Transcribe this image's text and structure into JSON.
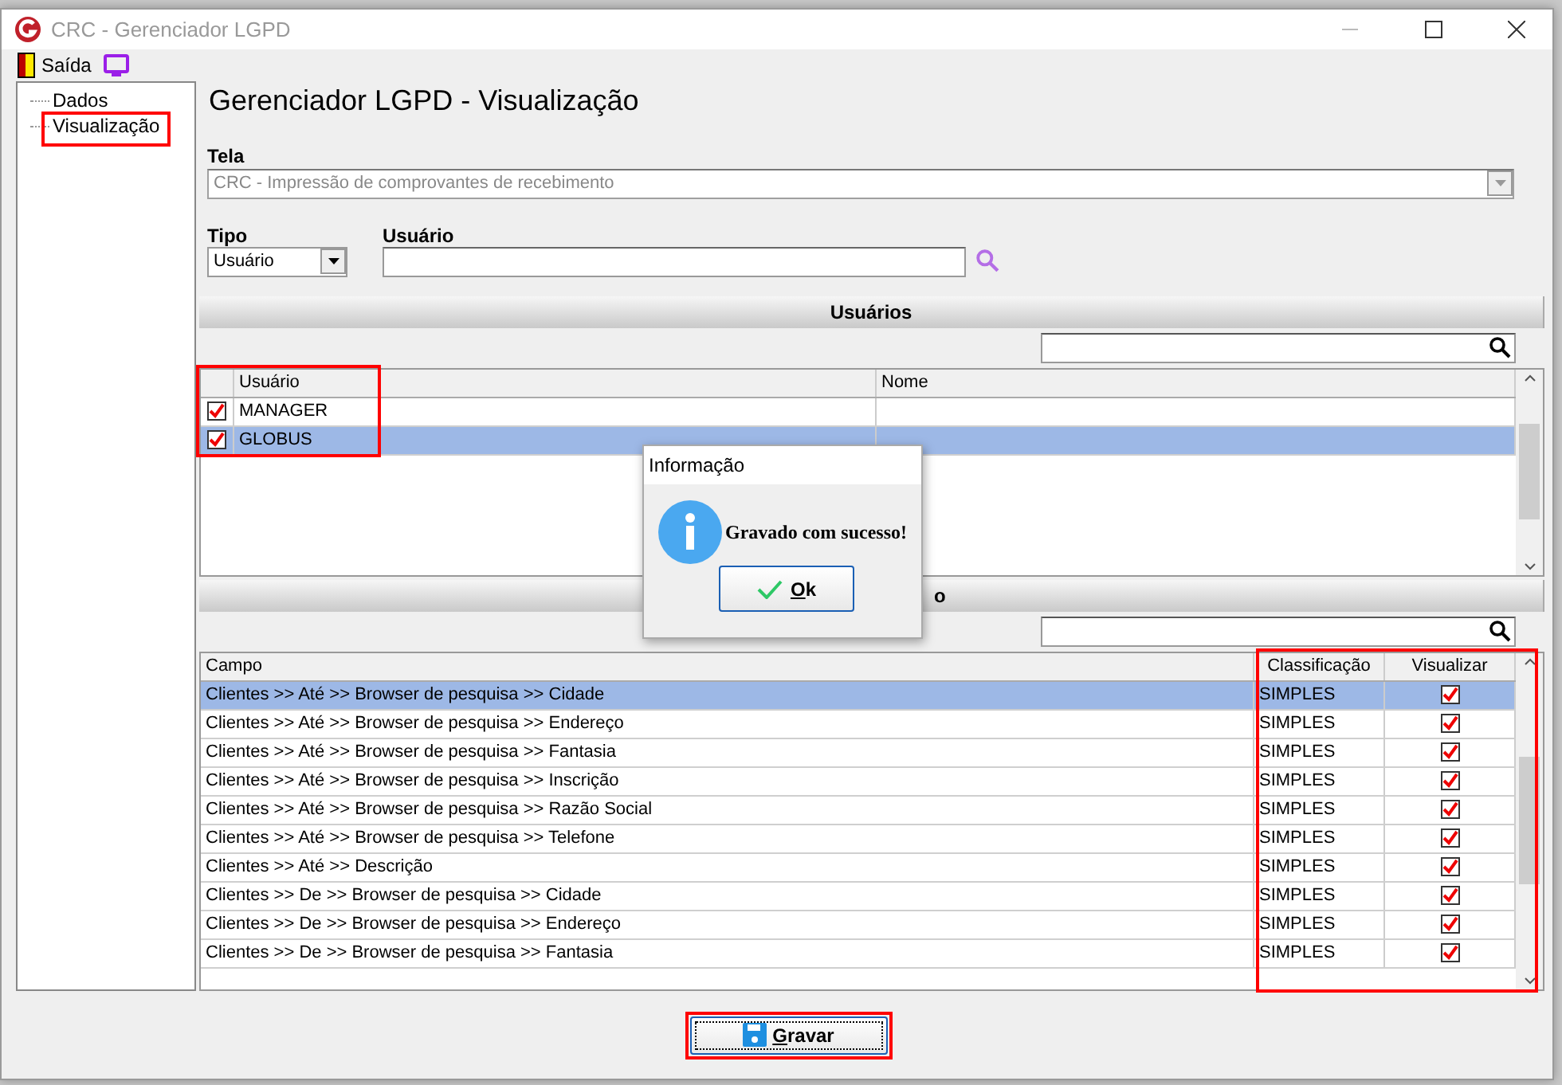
{
  "window": {
    "title": "CRC - Gerenciador LGPD"
  },
  "toolbar": {
    "exit_label": "Saída"
  },
  "tree": [
    {
      "label": "Dados",
      "annotated": false
    },
    {
      "label": "Visualização",
      "annotated": true
    }
  ],
  "heading": "Gerenciador LGPD - Visualização",
  "tela": {
    "label": "Tela",
    "value": "CRC - Impressão de comprovantes de recebimento",
    "disabled": true
  },
  "tipo": {
    "label": "Tipo",
    "value": "Usuário"
  },
  "usuario": {
    "label": "Usuário"
  },
  "users_section": {
    "title": "Usuários",
    "annotated": true,
    "columns": [
      "Usuário",
      "Nome"
    ],
    "rows": [
      {
        "usuario": "MANAGER",
        "checked": true,
        "selected": false
      },
      {
        "usuario": "GLOBUS",
        "checked": true,
        "selected": true
      }
    ]
  },
  "fields_section": {
    "title": "o",
    "annotated": true,
    "columns": [
      "Campo",
      "Classificação",
      "Visualizar"
    ],
    "rows": [
      {
        "campo": "Clientes >> Até >> Browser de pesquisa >> Cidade",
        "classificacao": "SIMPLES",
        "visualizar": true,
        "selected": true
      },
      {
        "campo": "Clientes >> Até >> Browser de pesquisa >> Endereço",
        "classificacao": "SIMPLES",
        "visualizar": true,
        "selected": false
      },
      {
        "campo": "Clientes >> Até >> Browser de pesquisa >> Fantasia",
        "classificacao": "SIMPLES",
        "visualizar": true,
        "selected": false
      },
      {
        "campo": "Clientes >> Até >> Browser de pesquisa >> Inscrição",
        "classificacao": "SIMPLES",
        "visualizar": true,
        "selected": false
      },
      {
        "campo": "Clientes >> Até >> Browser de pesquisa >> Razão Social",
        "classificacao": "SIMPLES",
        "visualizar": true,
        "selected": false
      },
      {
        "campo": "Clientes >> Até >> Browser de pesquisa >> Telefone",
        "classificacao": "SIMPLES",
        "visualizar": true,
        "selected": false
      },
      {
        "campo": "Clientes >> Até >> Descrição",
        "classificacao": "SIMPLES",
        "visualizar": true,
        "selected": false
      },
      {
        "campo": "Clientes >> De >> Browser de pesquisa >> Cidade",
        "classificacao": "SIMPLES",
        "visualizar": true,
        "selected": false
      },
      {
        "campo": "Clientes >> De >> Browser de pesquisa >> Endereço",
        "classificacao": "SIMPLES",
        "visualizar": true,
        "selected": false
      },
      {
        "campo": "Clientes >> De >> Browser de pesquisa >> Fantasia",
        "classificacao": "SIMPLES",
        "visualizar": true,
        "selected": false
      }
    ]
  },
  "save_button": {
    "label": "Gravar",
    "annotated": true
  },
  "dialog": {
    "title": "Informação",
    "message": "Gravado com sucesso!",
    "button": "Ok"
  }
}
